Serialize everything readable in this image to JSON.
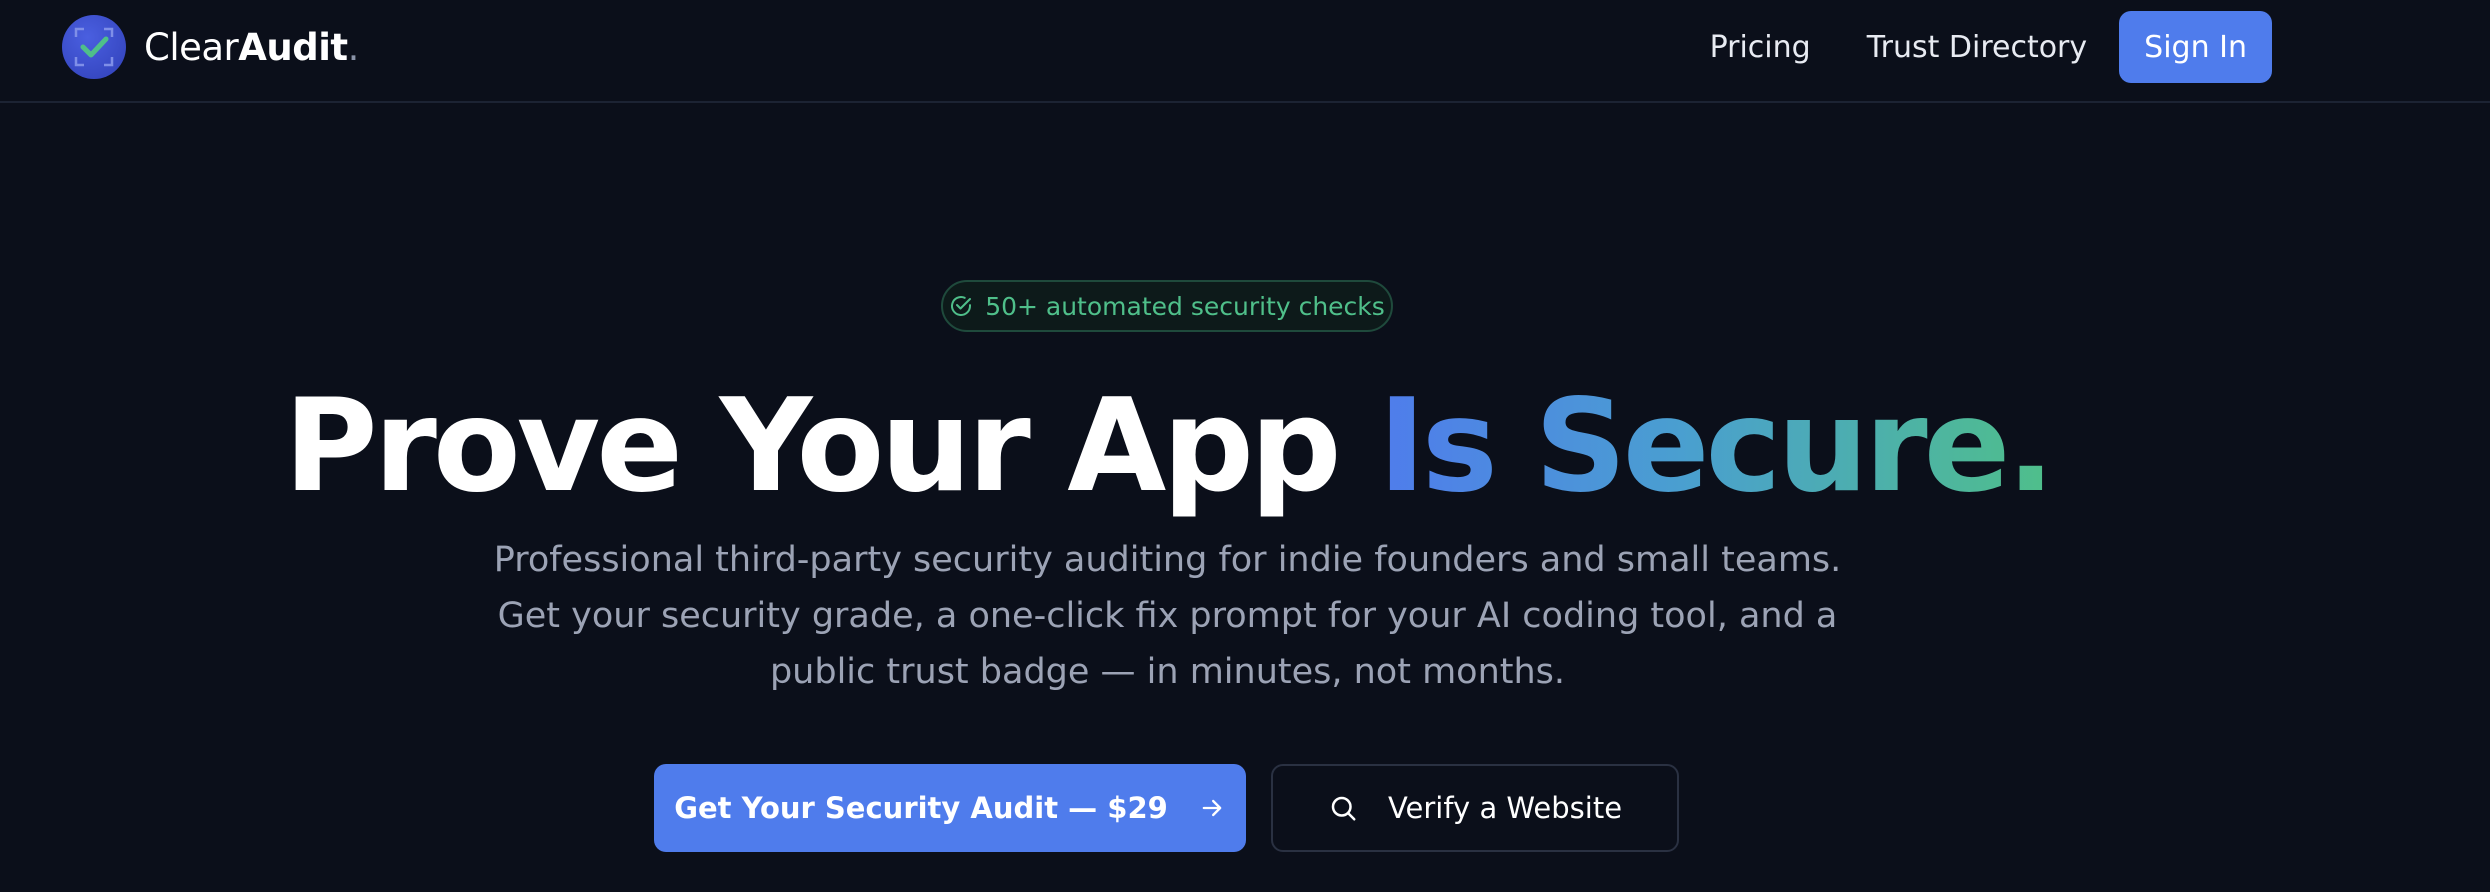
{
  "brand": {
    "name_light": "Clear",
    "name_bold": "Audit",
    "name_dot": ".",
    "accent_color": "#4f7cec",
    "success_color": "#4fbf8a"
  },
  "nav": {
    "links": [
      "Pricing",
      "Trust Directory"
    ],
    "signin_label": "Sign In"
  },
  "hero": {
    "badge": {
      "icon": "check-circle-icon",
      "text": "50+ automated security checks"
    },
    "headline_plain": "Prove Your App ",
    "headline_gradient": "Is Secure.",
    "subtitle_lines": [
      "Professional third-party security auditing for indie founders and small teams.",
      "Get your security grade, a one-click fix prompt for your AI coding tool, and a",
      "public trust badge — in minutes, not months."
    ],
    "primary_cta": {
      "label": "Get Your Security Audit — $29",
      "icon": "arrow-right-icon"
    },
    "secondary_cta": {
      "label": "Verify a Website",
      "icon": "search-icon"
    }
  }
}
